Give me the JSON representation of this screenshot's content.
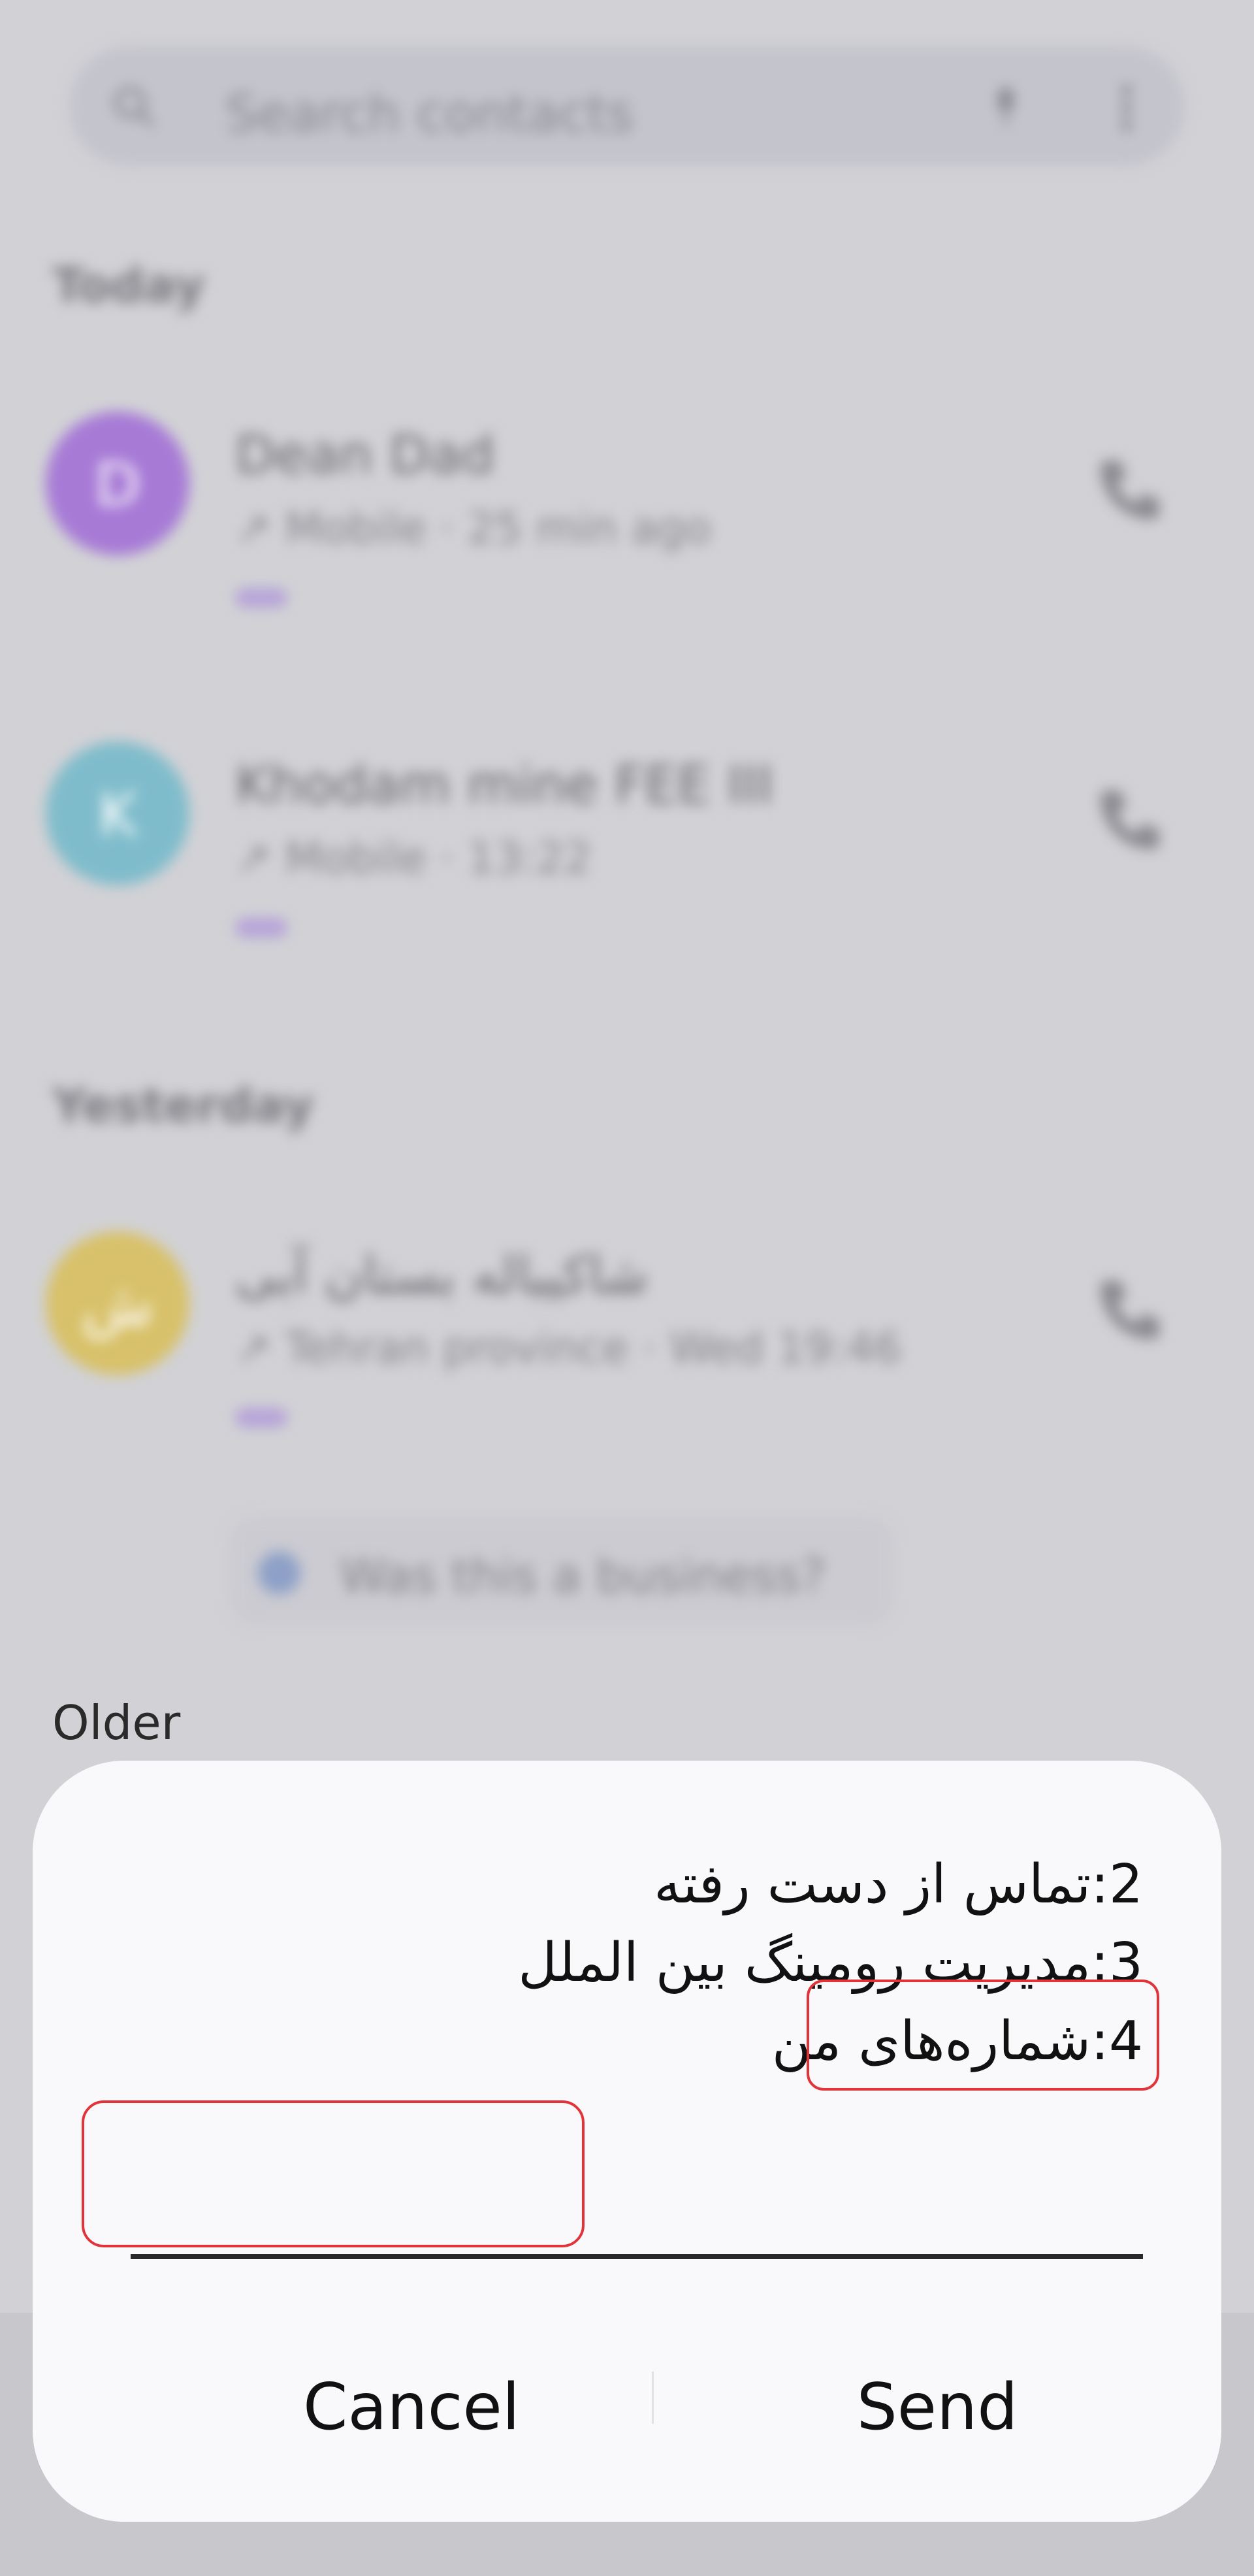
{
  "search": {
    "placeholder": "Search contacts"
  },
  "sections": {
    "today": "Today",
    "yesterday": "Yesterday",
    "older": "Older"
  },
  "calls": [
    {
      "initial": "D",
      "name": "Dean Dad",
      "meta": "↗ Mobile · 25 min ago",
      "color": "#a77ad6"
    },
    {
      "initial": "K",
      "name": "Khodam mine FEE III",
      "meta": "↗ Mobile · 13:22",
      "color": "#7fbccb"
    },
    {
      "initial": "ش",
      "name": "شاکیباله بستان آبی",
      "meta": "↗ Tehran province · Wed 19:46",
      "color": "#d8c16a"
    }
  ],
  "spam_chip": {
    "label": "Was this a business?"
  },
  "dialog": {
    "lines": [
      "2:تماس از دست رفته",
      "3:مدیریت رومینگ بین الملل",
      "4:شماره‌های من"
    ],
    "input_value": "",
    "cancel_label": "Cancel",
    "send_label": "Send"
  }
}
